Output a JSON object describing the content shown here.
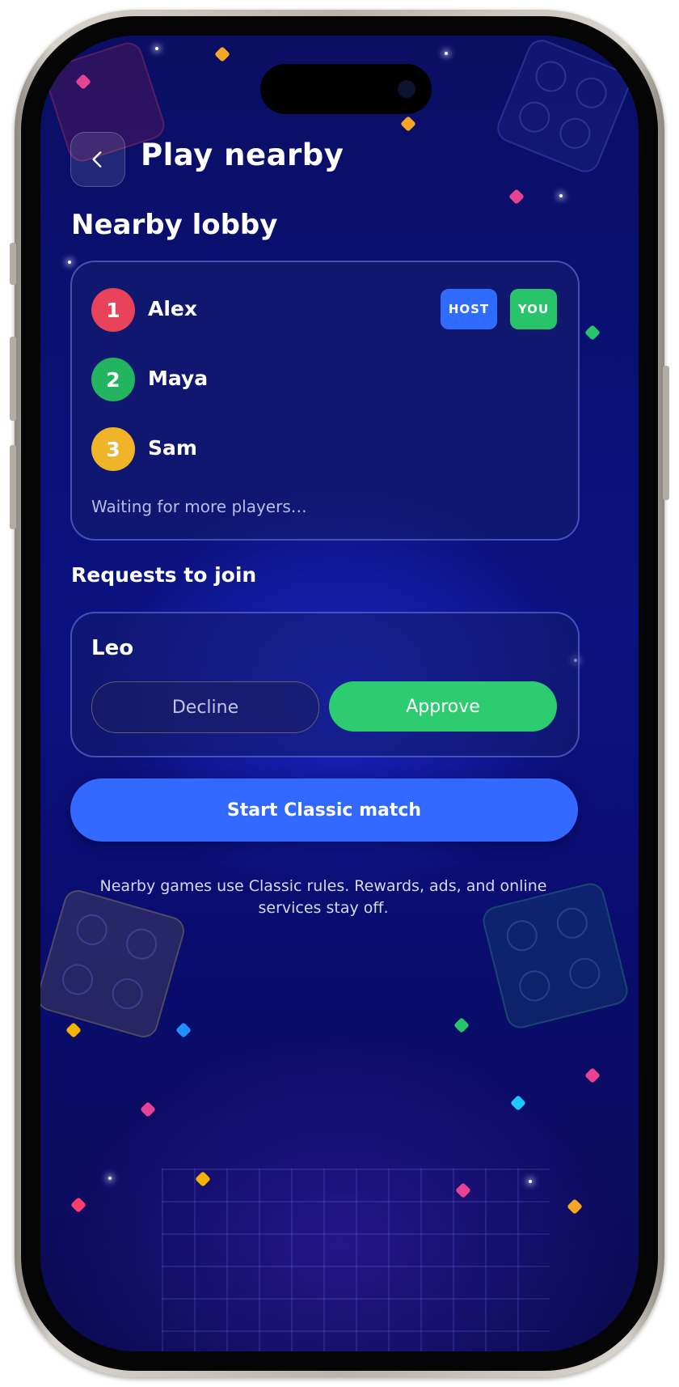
{
  "header": {
    "title": "Play nearby"
  },
  "lobby": {
    "heading": "Nearby lobby",
    "players": [
      {
        "number": "1",
        "name": "Alex",
        "color": "#e8435a"
      },
      {
        "number": "2",
        "name": "Maya",
        "color": "#22b45e"
      },
      {
        "number": "3",
        "name": "Sam",
        "color": "#f0b429"
      }
    ],
    "badges": {
      "host": "HOST",
      "you": "YOU",
      "host_color": "#2f6bff",
      "you_color": "#27c46a"
    },
    "status": "Waiting for more players…"
  },
  "requests": {
    "heading": "Requests to join",
    "items": [
      {
        "name": "Leo",
        "decline_label": "Decline",
        "approve_label": "Approve"
      }
    ]
  },
  "actions": {
    "start_label": "Start Classic match"
  },
  "footer": {
    "note": "Nearby games use Classic rules. Rewards, ads, and online services stay off."
  },
  "colors": {
    "accent": "#3369ff",
    "approve": "#2ecc71",
    "background": "#0b1180"
  }
}
